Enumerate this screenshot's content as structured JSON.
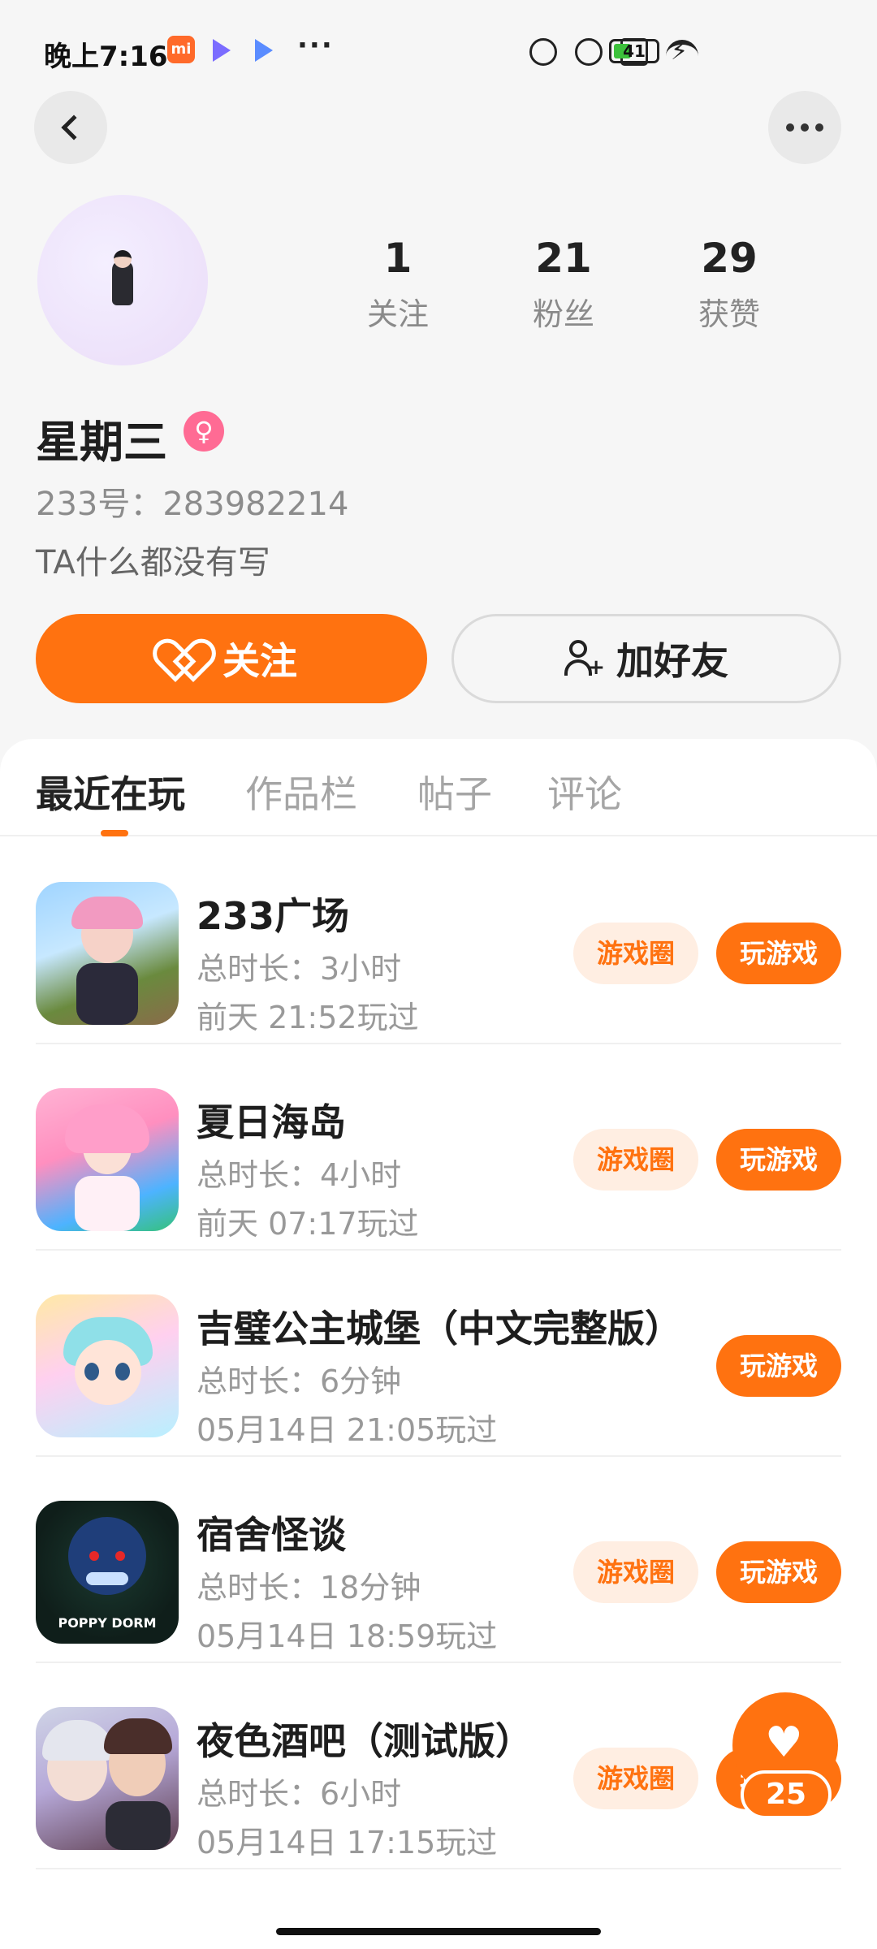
{
  "status_bar": {
    "time": "晚上7:16",
    "mi_badge": "mi",
    "more": "···",
    "battery": "41",
    "battery_level": 0.41,
    "colors": {
      "battery_fill": "#3cc13b"
    }
  },
  "profile": {
    "name": "星期三",
    "gender_icon": "female-icon",
    "uid": "233号：283982214",
    "bio": "TA什么都没有写",
    "stats": [
      {
        "value": "1",
        "label": "关注"
      },
      {
        "value": "21",
        "label": "粉丝"
      },
      {
        "value": "29",
        "label": "获赞"
      }
    ]
  },
  "actions": {
    "follow_label": "关注",
    "add_friend_label": "加好友"
  },
  "tabs": [
    "最近在玩",
    "作品栏",
    "帖子",
    "评论"
  ],
  "games": [
    {
      "title": "233广场",
      "duration": "总时长：3小时",
      "last_played": "前天 21:52玩过",
      "circle_label": "游戏圈",
      "play_label": "玩游戏",
      "has_circle": true
    },
    {
      "title": "夏日海岛",
      "duration": "总时长：4小时",
      "last_played": "前天 07:17玩过",
      "circle_label": "游戏圈",
      "play_label": "玩游戏",
      "has_circle": true
    },
    {
      "title": "吉璧公主城堡（中文完整版）",
      "duration": "总时长：6分钟",
      "last_played": "05月14日 21:05玩过",
      "circle_label": "",
      "play_label": "玩游戏",
      "has_circle": false
    },
    {
      "title": "宿舍怪谈",
      "duration": "总时长：18分钟",
      "last_played": "05月14日 18:59玩过",
      "circle_label": "游戏圈",
      "play_label": "玩游戏",
      "has_circle": true
    },
    {
      "title": "夜色酒吧（测试版）",
      "duration": "总时长：6小时",
      "last_played": "05月14日 17:15玩过",
      "circle_label": "游戏圈",
      "play_label": "玩游戏",
      "has_circle": true
    }
  ],
  "like_fab": {
    "count": "25"
  },
  "colors": {
    "accent": "#ff7210",
    "accent_light": "#ffeee2",
    "gender_badge": "#ff6b94"
  }
}
